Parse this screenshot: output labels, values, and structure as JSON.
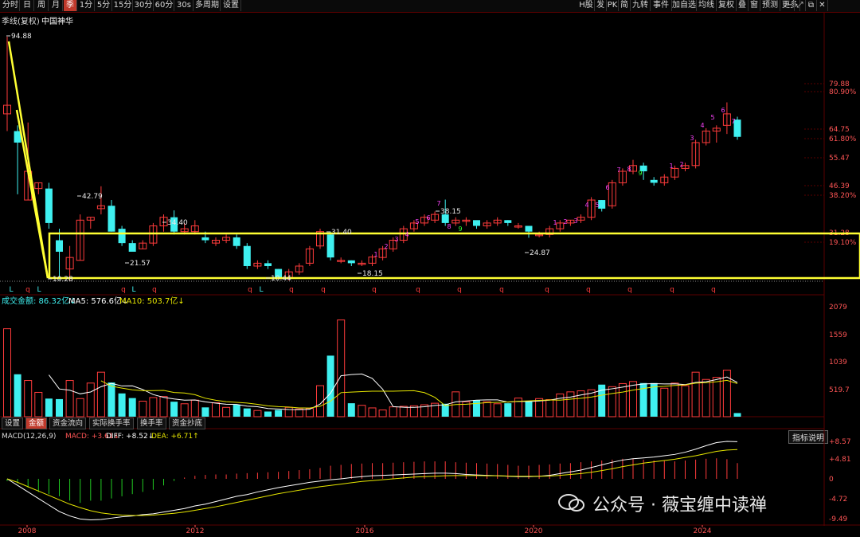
{
  "toolbar": {
    "left": [
      "分时",
      "日",
      "周",
      "月",
      "季",
      "1分",
      "5分",
      "15分",
      "30分",
      "60分",
      "30s",
      "多周期",
      "设置"
    ],
    "active": "季",
    "right": [
      "H股",
      "发",
      "PK",
      "简",
      "九转",
      "事件",
      "加自选",
      "均线",
      "复权",
      "叠",
      "窗",
      "预测",
      "更多"
    ]
  },
  "header": {
    "period": "季线(复权)",
    "stock": "中国神华"
  },
  "price_axis": [
    "79.88",
    "80.90%",
    "64.75",
    "61.80%",
    "55.47",
    "46.39",
    "38.20%",
    "31.28",
    "19.10%"
  ],
  "price_labels": {
    "high": "94.88",
    "p1": "42.79",
    "p2": "34.40",
    "p3": "21.57",
    "p4": "31.40",
    "p5": "18.15",
    "p6": "38.15",
    "p7": "24.87",
    "low1": "10.28",
    "low2": "10.44"
  },
  "volume": {
    "legend_prefix": "成交金额: ",
    "legend_value": "86.32亿↓",
    "ma5": "MA5: 576.6亿↓",
    "ma10": "MA10: 503.7亿↓",
    "axis": [
      "2079",
      "1559",
      "1039",
      "519.7"
    ]
  },
  "tabs": [
    "设置",
    "金额",
    "资金流向",
    "实际换手率",
    "换手率",
    "资金抄底"
  ],
  "active_tab": "金额",
  "macd": {
    "title": "MACD(12,26,9)",
    "macd": "MACD: +3.61↓",
    "diff": "DIFF: +8.52↓",
    "dea": "DEA: +6.71↑",
    "button": "指标说明",
    "axis": [
      "+8.57",
      "+4.81",
      "0",
      "-4.72",
      "-9.49"
    ]
  },
  "years": [
    "2008",
    "2012",
    "2016",
    "2020",
    "2024"
  ],
  "watermark": "公众号 · 薇宝缠中读禅",
  "colors": {
    "up": "#ff3b3b",
    "down": "#3ff0f0",
    "ma": "#ffffff",
    "ma2": "#e6e600",
    "box": "#ffff33",
    "bg": "#000000"
  },
  "chart_data": {
    "type": "candlestick",
    "period": "quarterly",
    "candles": [
      [
        1,
        68,
        71,
        94.88,
        62
      ],
      [
        2,
        62,
        58,
        64,
        40
      ],
      [
        3,
        38,
        48,
        65,
        38
      ],
      [
        4,
        42,
        44,
        44,
        40
      ],
      [
        5,
        42,
        30,
        44,
        28
      ],
      [
        6,
        24,
        20,
        28,
        10.28
      ],
      [
        7,
        14,
        18,
        22,
        10
      ],
      [
        8,
        17,
        31,
        33,
        17
      ],
      [
        9,
        31,
        32,
        32,
        28
      ],
      [
        10,
        35,
        36,
        42.79,
        33
      ],
      [
        11,
        36,
        27,
        38,
        27
      ],
      [
        12,
        28,
        23,
        29,
        22
      ],
      [
        13,
        23,
        20,
        24,
        21.57
      ],
      [
        14,
        21,
        23,
        24,
        21
      ],
      [
        15,
        23,
        29,
        30,
        22
      ],
      [
        16,
        29,
        32,
        33,
        27
      ],
      [
        17,
        32,
        27,
        34.4,
        26
      ],
      [
        18,
        27,
        28,
        30,
        26
      ],
      [
        19,
        27,
        29,
        31,
        26
      ],
      [
        20,
        25,
        24,
        27,
        23
      ],
      [
        21,
        23,
        24,
        25,
        22
      ],
      [
        22,
        24,
        25,
        26,
        23
      ],
      [
        23,
        25,
        22,
        26,
        21
      ],
      [
        24,
        22,
        15,
        23,
        14
      ],
      [
        25,
        15,
        16,
        17,
        14
      ],
      [
        26,
        16,
        15,
        17,
        14
      ],
      [
        27,
        14,
        11,
        14,
        10.44
      ],
      [
        28,
        11,
        13,
        14,
        10
      ],
      [
        29,
        13,
        15,
        16,
        12
      ],
      [
        30,
        16,
        21,
        22,
        15
      ],
      [
        31,
        22,
        27,
        28,
        21
      ],
      [
        32,
        26,
        18,
        27,
        17
      ],
      [
        33,
        17,
        17,
        18,
        16
      ],
      [
        34,
        17,
        16,
        17,
        15
      ],
      [
        35,
        16,
        16,
        17,
        15
      ],
      [
        36,
        16,
        18.15,
        19,
        15
      ],
      [
        37,
        18,
        21,
        22,
        17
      ],
      [
        38,
        21,
        24,
        25,
        20
      ],
      [
        39,
        24,
        28,
        29,
        23
      ],
      [
        40,
        28,
        30,
        31,
        27
      ],
      [
        41,
        30,
        32,
        33,
        29
      ],
      [
        42,
        31,
        33,
        34,
        30
      ],
      [
        43,
        33,
        30,
        38.15,
        29
      ],
      [
        44,
        30,
        31,
        32,
        29
      ],
      [
        45,
        31,
        31,
        32,
        29
      ],
      [
        46,
        31,
        29,
        30,
        28
      ],
      [
        47,
        29,
        30,
        31,
        28
      ],
      [
        48,
        30,
        31,
        32,
        29
      ],
      [
        49,
        31,
        30,
        31,
        29
      ],
      [
        50,
        29,
        29,
        30,
        28
      ],
      [
        51,
        29,
        27,
        29,
        24.87
      ],
      [
        52,
        26,
        26,
        27,
        25
      ],
      [
        53,
        26,
        28,
        29,
        25
      ],
      [
        54,
        28,
        30,
        31,
        27
      ],
      [
        55,
        30,
        31,
        31,
        29
      ],
      [
        56,
        31,
        32,
        33,
        30
      ],
      [
        57,
        32,
        38,
        39,
        31
      ],
      [
        58,
        38,
        35,
        38,
        34
      ],
      [
        59,
        36,
        44,
        45,
        35
      ],
      [
        60,
        44,
        48,
        49,
        43
      ],
      [
        61,
        48,
        50,
        52,
        47
      ],
      [
        62,
        50,
        48,
        51,
        45
      ],
      [
        63,
        45,
        44,
        46,
        43
      ],
      [
        64,
        44,
        46,
        47,
        43
      ],
      [
        65,
        46,
        49,
        50,
        45
      ],
      [
        66,
        49,
        50,
        51,
        48
      ],
      [
        67,
        50,
        58,
        59,
        49
      ],
      [
        68,
        58,
        62,
        63,
        57
      ],
      [
        69,
        62,
        63,
        64,
        58
      ],
      [
        70,
        64,
        68,
        72,
        61
      ],
      [
        71,
        66,
        60,
        67,
        59
      ]
    ],
    "y_axis": [
      "79.88",
      "64.75",
      "55.47",
      "46.39",
      "31.28"
    ],
    "fib_levels": [
      "80.90%",
      "61.80%",
      "38.20%",
      "19.10%"
    ],
    "annotations": [
      "94.88",
      "42.79",
      "34.40",
      "21.57",
      "31.40",
      "18.15",
      "38.15",
      "24.87",
      "10.28",
      "10.44"
    ]
  }
}
